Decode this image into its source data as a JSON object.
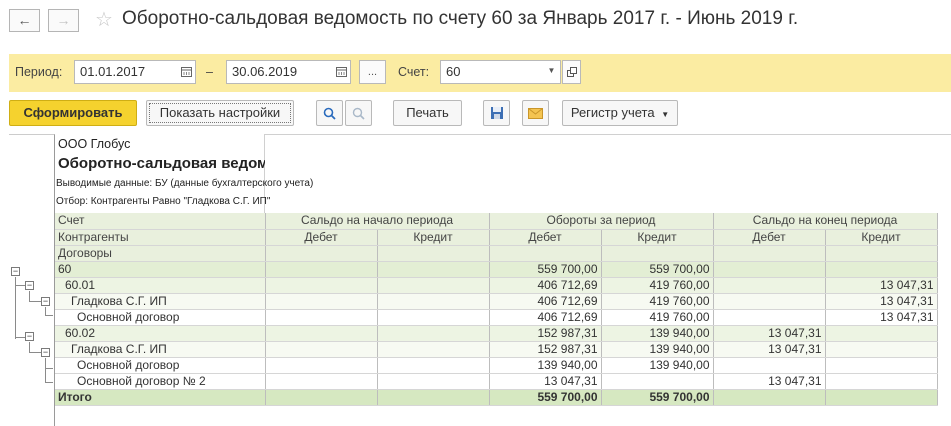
{
  "window": {
    "title": "Оборотно-сальдовая ведомость по счету 60 за Январь 2017 г. - Июнь 2019 г.",
    "back_icon": "←",
    "forward_icon": "→",
    "star_icon": "☆"
  },
  "filters": {
    "period_label": "Период:",
    "date_from": "01.01.2017",
    "dash": "–",
    "date_to": "30.06.2019",
    "ellipsis": "...",
    "account_label": "Счет:",
    "account_value": "60"
  },
  "toolbar": {
    "generate": "Сформировать",
    "show_settings": "Показать настройки",
    "print": "Печать",
    "register": "Регистр учета"
  },
  "report": {
    "org": "ООО  Глобус",
    "title": "Оборотно-сальдовая ведомость по счету 60 за Январь 2017 г. - Июнь 2019 г.",
    "output_data": "Выводимые данные: БУ (данные бухгалтерского учета)",
    "filter": "Отбор: Контрагенты Равно \"Гладкова С.Г. ИП\"",
    "headers": {
      "account": "Счет",
      "contractors": "Контрагенты",
      "contracts": "Договоры",
      "opening": "Сальдо на начало периода",
      "turnover": "Обороты за период",
      "closing": "Сальдо на конец периода",
      "debit": "Дебет",
      "credit": "Кредит"
    },
    "rows": [
      {
        "name": "60",
        "od": "",
        "oc": "",
        "td": "559 700,00",
        "tc": "559 700,00",
        "cd": "",
        "cc": ""
      },
      {
        "name": "60.01",
        "od": "",
        "oc": "",
        "td": "406 712,69",
        "tc": "419 760,00",
        "cd": "",
        "cc": "13 047,31"
      },
      {
        "name": "Гладкова С.Г. ИП",
        "od": "",
        "oc": "",
        "td": "406 712,69",
        "tc": "419 760,00",
        "cd": "",
        "cc": "13 047,31"
      },
      {
        "name": "Основной договор",
        "od": "",
        "oc": "",
        "td": "406 712,69",
        "tc": "419 760,00",
        "cd": "",
        "cc": "13 047,31"
      },
      {
        "name": "60.02",
        "od": "",
        "oc": "",
        "td": "152 987,31",
        "tc": "139 940,00",
        "cd": "13 047,31",
        "cc": ""
      },
      {
        "name": "Гладкова С.Г. ИП",
        "od": "",
        "oc": "",
        "td": "152 987,31",
        "tc": "139 940,00",
        "cd": "13 047,31",
        "cc": ""
      },
      {
        "name": "Основной договор",
        "od": "",
        "oc": "",
        "td": "139 940,00",
        "tc": "139 940,00",
        "cd": "",
        "cc": ""
      },
      {
        "name": "Основной договор № 2",
        "od": "",
        "oc": "",
        "td": "13 047,31",
        "tc": "",
        "cd": "13 047,31",
        "cc": ""
      }
    ],
    "total": {
      "name": "Итого",
      "od": "",
      "oc": "",
      "td": "559 700,00",
      "tc": "559 700,00",
      "cd": "",
      "cc": ""
    }
  },
  "colors": {
    "filter_bg": "#fbeca2",
    "primary_button": "#f5d22e",
    "header_bg": "#e9f0dd",
    "total_bg": "#d6e8c1"
  }
}
